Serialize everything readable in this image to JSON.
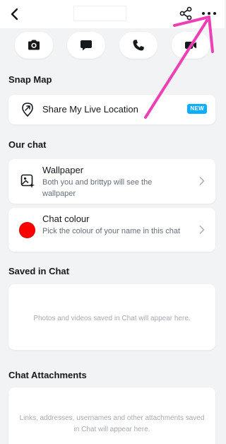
{
  "header": {
    "back_icon": "chevron-left-icon",
    "share_icon": "share-icon",
    "more_icon": "more-horizontal-icon"
  },
  "actions": [
    {
      "icon": "camera-icon"
    },
    {
      "icon": "chat-bubble-icon"
    },
    {
      "icon": "phone-icon"
    },
    {
      "icon": "video-camera-icon"
    }
  ],
  "snap_map": {
    "title": "Snap Map",
    "share_label": "Share My Live Location",
    "badge": "NEW",
    "badge_color": "#0fadff"
  },
  "our_chat": {
    "title": "Our chat",
    "wallpaper": {
      "title": "Wallpaper",
      "subtitle": "Both you and brittyp will see the wallpaper"
    },
    "chat_colour": {
      "title": "Chat colour",
      "subtitle": "Pick the colour of your name in this chat",
      "color": "#ff0000"
    }
  },
  "saved_in_chat": {
    "title": "Saved in Chat",
    "empty_text": "Photos and videos saved in Chat will appear here."
  },
  "chat_attachments": {
    "title": "Chat Attachments",
    "empty_text": "Links, addresses, usernames and other attachments saved in Chat will appear here."
  },
  "annotation": {
    "arrow_color": "#ee3fb5"
  }
}
